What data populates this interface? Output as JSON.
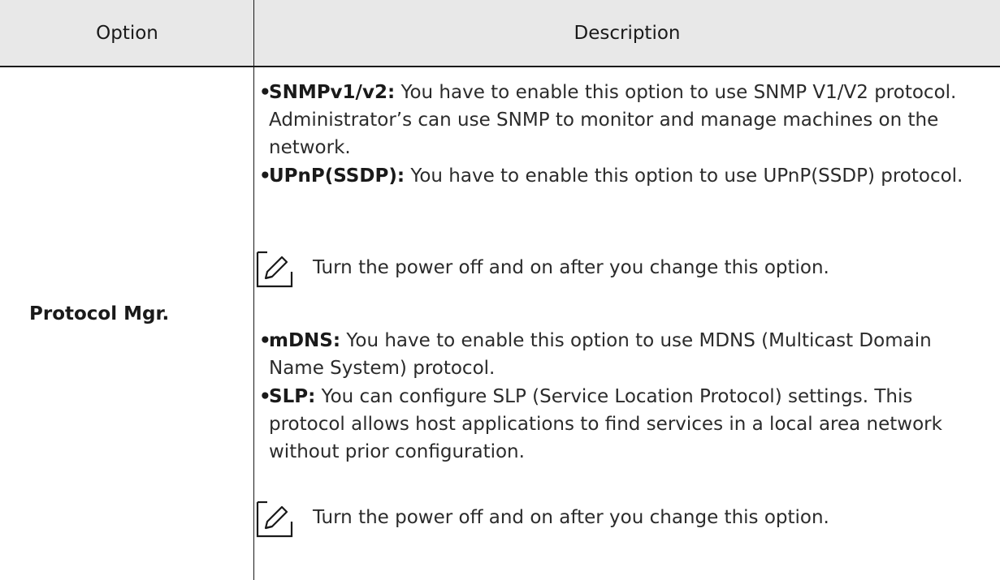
{
  "table": {
    "headers": {
      "option": "Option",
      "description": "Description"
    },
    "rows": [
      {
        "option": "Protocol Mgr.",
        "items": [
          {
            "term": "SNMPv1/v2:",
            "text": " You have to enable this option to use SNMP V1/V2 protocol. Administrator’s can use SNMP to monitor and manage machines on the network."
          },
          {
            "term": "UPnP(SSDP):",
            "text": " You have to enable this option to use UPnP(SSDP) protocol."
          },
          {
            "term": "mDNS:",
            "text": " You have to enable this option to use MDNS (Multicast Domain Name System) protocol."
          },
          {
            "term": "SLP:",
            "text": " You can configure SLP (Service Location Protocol) settings. This protocol allows host applications to find services in a local area network without prior configuration."
          }
        ],
        "notes": [
          {
            "icon": "note-pencil-icon",
            "text": "Turn the power off and on after you change this option."
          },
          {
            "icon": "note-pencil-icon",
            "text": "Turn the power off and on after you change this option."
          }
        ]
      }
    ]
  }
}
